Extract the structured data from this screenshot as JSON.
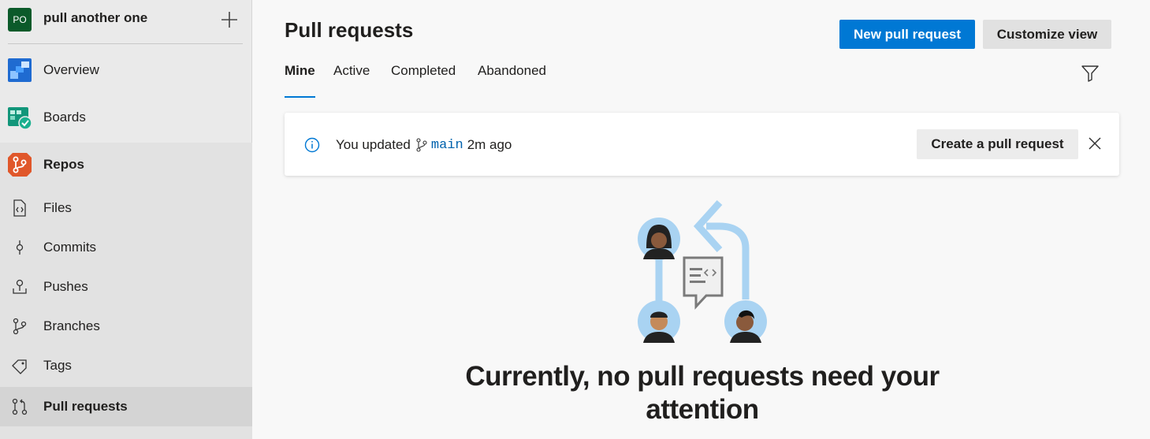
{
  "project": {
    "initials": "PO",
    "name": "pull another one"
  },
  "nav": {
    "overview": "Overview",
    "boards": "Boards",
    "repos": "Repos",
    "files": "Files",
    "commits": "Commits",
    "pushes": "Pushes",
    "branches": "Branches",
    "tags": "Tags",
    "pull_requests": "Pull requests"
  },
  "header": {
    "title": "Pull requests",
    "new_pr_label": "New pull request",
    "customize_label": "Customize view"
  },
  "tabs": [
    "Mine",
    "Active",
    "Completed",
    "Abandoned"
  ],
  "banner": {
    "prefix": "You updated",
    "branch": "main",
    "suffix": "2m ago",
    "action_label": "Create a pull request"
  },
  "empty_state": {
    "message": "Currently, no pull requests need your attention"
  },
  "colors": {
    "accent": "#0078d4",
    "project_avatar": "#0b5a2a",
    "repos_orange": "#e0572a"
  }
}
